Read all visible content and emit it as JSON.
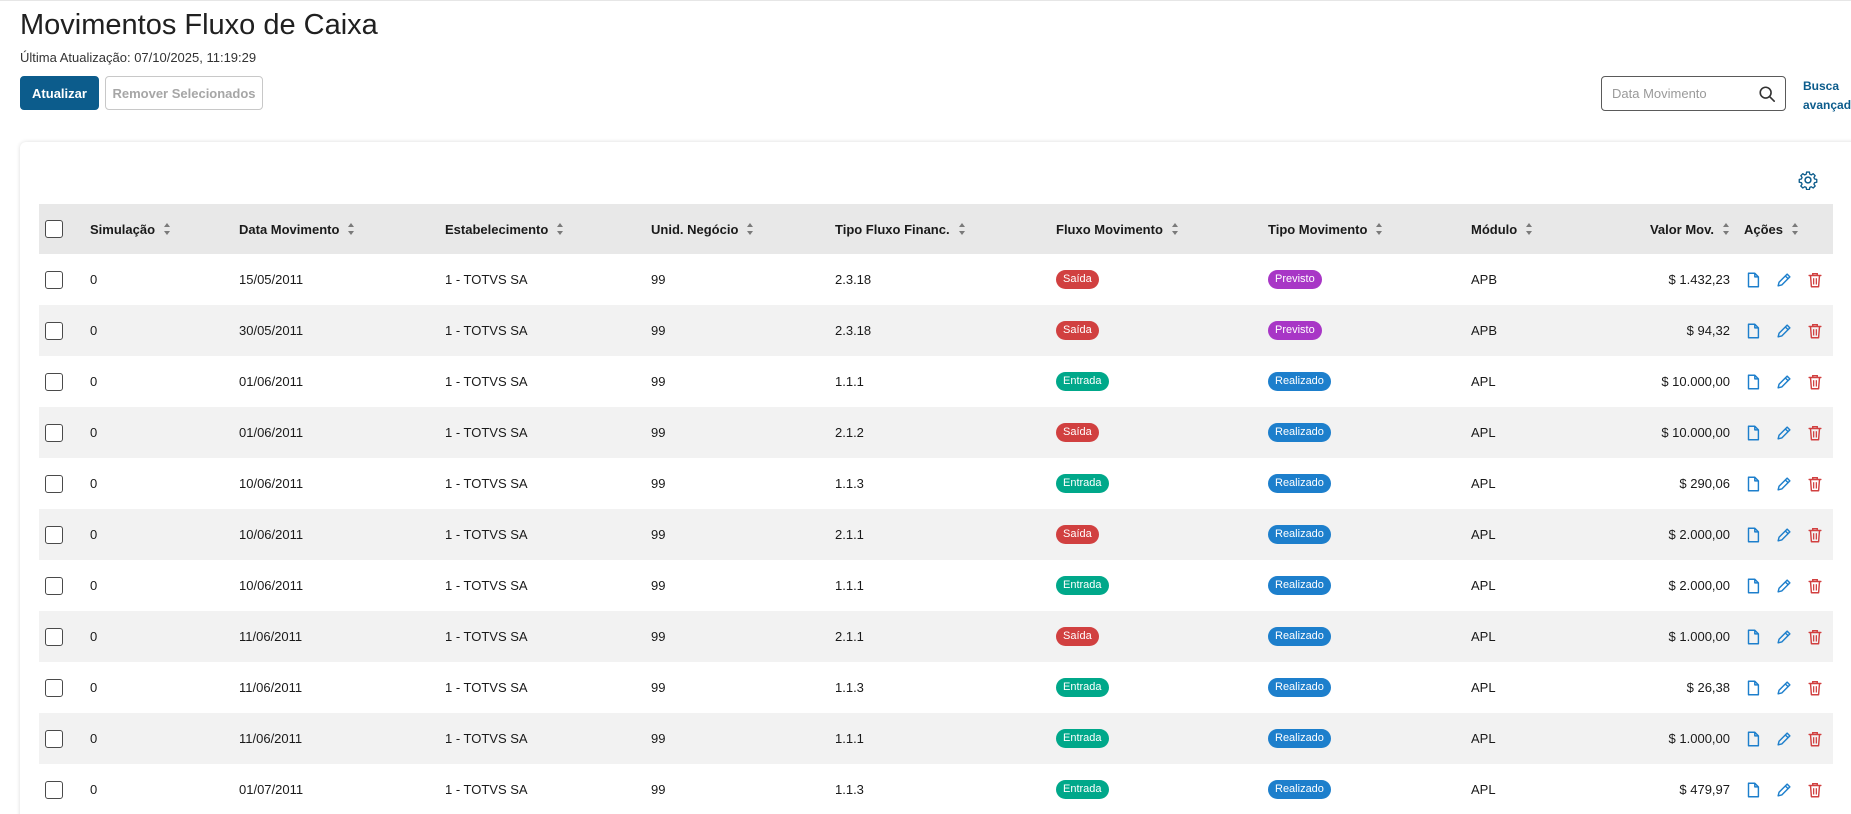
{
  "header": {
    "title": "Movimentos Fluxo de Caixa",
    "last_update_label": "Última Atualização:",
    "last_update_value": "07/10/2025, 11:19:29"
  },
  "toolbar": {
    "refresh_label": "Atualizar",
    "remove_selected_label": "Remover Selecionados",
    "search_placeholder": "Data Movimento",
    "advanced_search_line1": "Busca",
    "advanced_search_line2": "avançada"
  },
  "colors": {
    "primary": "#0c5c8c",
    "saida": "#d14040",
    "entrada": "#00a88a",
    "previsto": "#a836c6",
    "realizado": "#1d7fcc",
    "action_icon": "#1d7fcc",
    "delete_icon": "#d14040"
  },
  "table": {
    "columns": {
      "simulacao": "Simulação",
      "data": "Data Movimento",
      "estabelecimento": "Estabelecimento",
      "unid": "Unid. Negócio",
      "tipo": "Tipo Fluxo Financ.",
      "fluxo": "Fluxo Movimento",
      "tipo_mov": "Tipo Movimento",
      "modulo": "Módulo",
      "valor": "Valor Mov.",
      "acoes": "Ações"
    },
    "rows": [
      {
        "sim": "0",
        "data": "15/05/2011",
        "est": "1 - TOTVS SA",
        "un": "99",
        "tipo": "2.3.18",
        "fluxo": "Saída",
        "tmov": "Previsto",
        "mod": "APB",
        "val": "$ 1.432,23"
      },
      {
        "sim": "0",
        "data": "30/05/2011",
        "est": "1 - TOTVS SA",
        "un": "99",
        "tipo": "2.3.18",
        "fluxo": "Saída",
        "tmov": "Previsto",
        "mod": "APB",
        "val": "$ 94,32"
      },
      {
        "sim": "0",
        "data": "01/06/2011",
        "est": "1 - TOTVS SA",
        "un": "99",
        "tipo": "1.1.1",
        "fluxo": "Entrada",
        "tmov": "Realizado",
        "mod": "APL",
        "val": "$ 10.000,00"
      },
      {
        "sim": "0",
        "data": "01/06/2011",
        "est": "1 - TOTVS SA",
        "un": "99",
        "tipo": "2.1.2",
        "fluxo": "Saída",
        "tmov": "Realizado",
        "mod": "APL",
        "val": "$ 10.000,00"
      },
      {
        "sim": "0",
        "data": "10/06/2011",
        "est": "1 - TOTVS SA",
        "un": "99",
        "tipo": "1.1.3",
        "fluxo": "Entrada",
        "tmov": "Realizado",
        "mod": "APL",
        "val": "$ 290,06"
      },
      {
        "sim": "0",
        "data": "10/06/2011",
        "est": "1 - TOTVS SA",
        "un": "99",
        "tipo": "2.1.1",
        "fluxo": "Saída",
        "tmov": "Realizado",
        "mod": "APL",
        "val": "$ 2.000,00"
      },
      {
        "sim": "0",
        "data": "10/06/2011",
        "est": "1 - TOTVS SA",
        "un": "99",
        "tipo": "1.1.1",
        "fluxo": "Entrada",
        "tmov": "Realizado",
        "mod": "APL",
        "val": "$ 2.000,00"
      },
      {
        "sim": "0",
        "data": "11/06/2011",
        "est": "1 - TOTVS SA",
        "un": "99",
        "tipo": "2.1.1",
        "fluxo": "Saída",
        "tmov": "Realizado",
        "mod": "APL",
        "val": "$ 1.000,00"
      },
      {
        "sim": "0",
        "data": "11/06/2011",
        "est": "1 - TOTVS SA",
        "un": "99",
        "tipo": "1.1.3",
        "fluxo": "Entrada",
        "tmov": "Realizado",
        "mod": "APL",
        "val": "$ 26,38"
      },
      {
        "sim": "0",
        "data": "11/06/2011",
        "est": "1 - TOTVS SA",
        "un": "99",
        "tipo": "1.1.1",
        "fluxo": "Entrada",
        "tmov": "Realizado",
        "mod": "APL",
        "val": "$ 1.000,00"
      },
      {
        "sim": "0",
        "data": "01/07/2011",
        "est": "1 - TOTVS SA",
        "un": "99",
        "tipo": "1.1.3",
        "fluxo": "Entrada",
        "tmov": "Realizado",
        "mod": "APL",
        "val": "$ 479,97"
      }
    ]
  }
}
